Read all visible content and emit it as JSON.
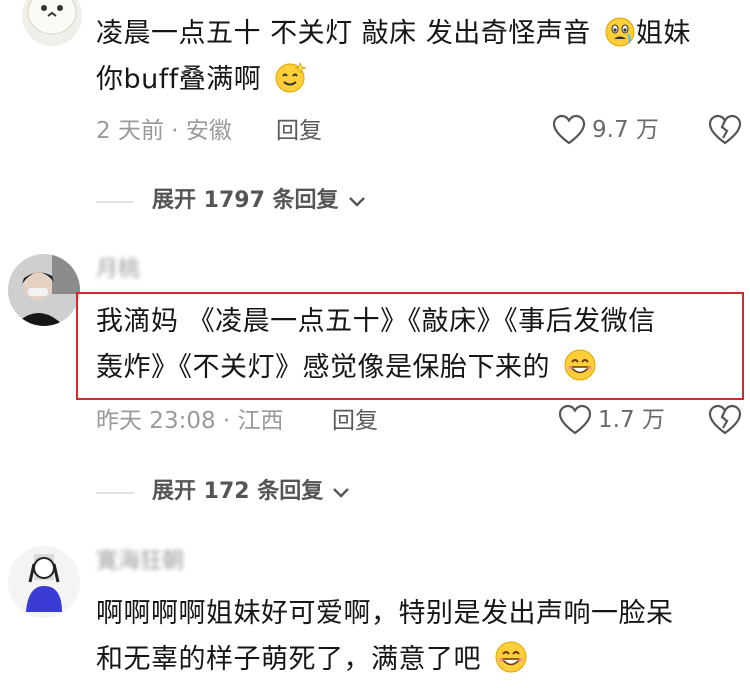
{
  "comment1": {
    "text_line1": "凌晨一点五十 不关灯 敲床 发出奇怪声音",
    "text_line1_tail": "姐妹",
    "text_line2": "你buff叠满啊",
    "time_location": "2 天前 · 安徽",
    "reply_label": "回复",
    "likes": "9.7 万",
    "expand_label": "展开 1797 条回复"
  },
  "comment2": {
    "username": "月桃",
    "text_line1": "我滴妈 《凌晨一点五十》《敲床》《事后发微信",
    "text_line2": "轰炸》《不关灯》感觉像是保胎下来的",
    "time_location": "昨天 23:08 · 江西",
    "reply_label": "回复",
    "likes": "1.7 万",
    "expand_label": "展开 172 条回复"
  },
  "comment3": {
    "username": "寛海狂朝",
    "text_line1": "啊啊啊啊姐妹好可爱啊，特别是发出声响一脸呆",
    "text_line2": "和无辜的样子萌死了，满意了吧"
  },
  "colors": {
    "highlight_border": "#d9252f",
    "meta_gray": "#9a9a9a"
  },
  "icons": [
    "heart-outline-icon",
    "broken-heart-icon",
    "chevron-down-icon",
    "fearful-emoji-icon",
    "dizzy-smile-emoji-icon",
    "grin-emoji-icon"
  ]
}
